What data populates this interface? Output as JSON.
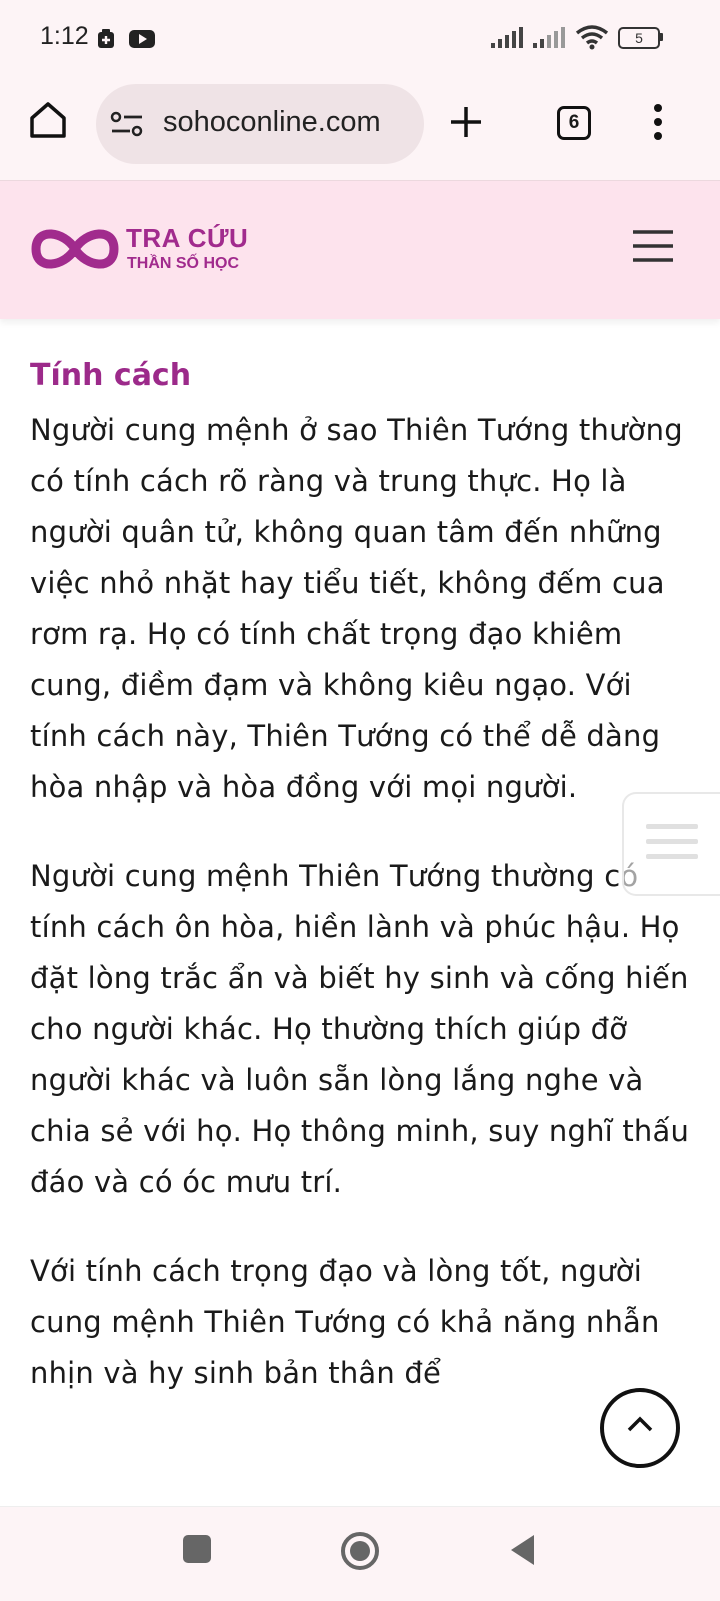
{
  "status": {
    "time": "1:12",
    "battery": "5"
  },
  "browser": {
    "url": "sohoconline.com",
    "tab_count": "6"
  },
  "site": {
    "logo_line1": "TRA CỨU",
    "logo_line2": "THẦN SỐ HỌC"
  },
  "article": {
    "heading": "Tính cách",
    "paragraphs": [
      "Người cung mệnh ở sao Thiên Tướng thường có tính cách rõ ràng và trung thực. Họ là người quân tử, không quan tâm đến những việc nhỏ nhặt hay tiểu tiết, không đếm cua rơm rạ. Họ có tính chất trọng đạo khiêm cung, điềm đạm và không kiêu ngạo. Với tính cách này, Thiên Tướng có thể dễ dàng hòa nhập và hòa đồng với mọi người.",
      "Người cung mệnh Thiên Tướng thường có tính cách ôn hòa, hiền lành và phúc hậu. Họ đặt lòng trắc ẩn và biết hy sinh và cống hiến cho người khác. Họ thường thích giúp đỡ người khác và luôn sẵn lòng lắng nghe và chia sẻ với họ. Họ thông minh, suy nghĩ thấu đáo và có óc mưu trí.",
      "Với tính cách trọng đạo và lòng tốt, người cung mệnh Thiên Tướng có khả năng nhẫn nhịn và hy sinh bản thân để"
    ]
  },
  "colors": {
    "brand": "#a12b8d",
    "header_bg": "#fde3ed",
    "browser_bg": "#fdf4f6"
  }
}
